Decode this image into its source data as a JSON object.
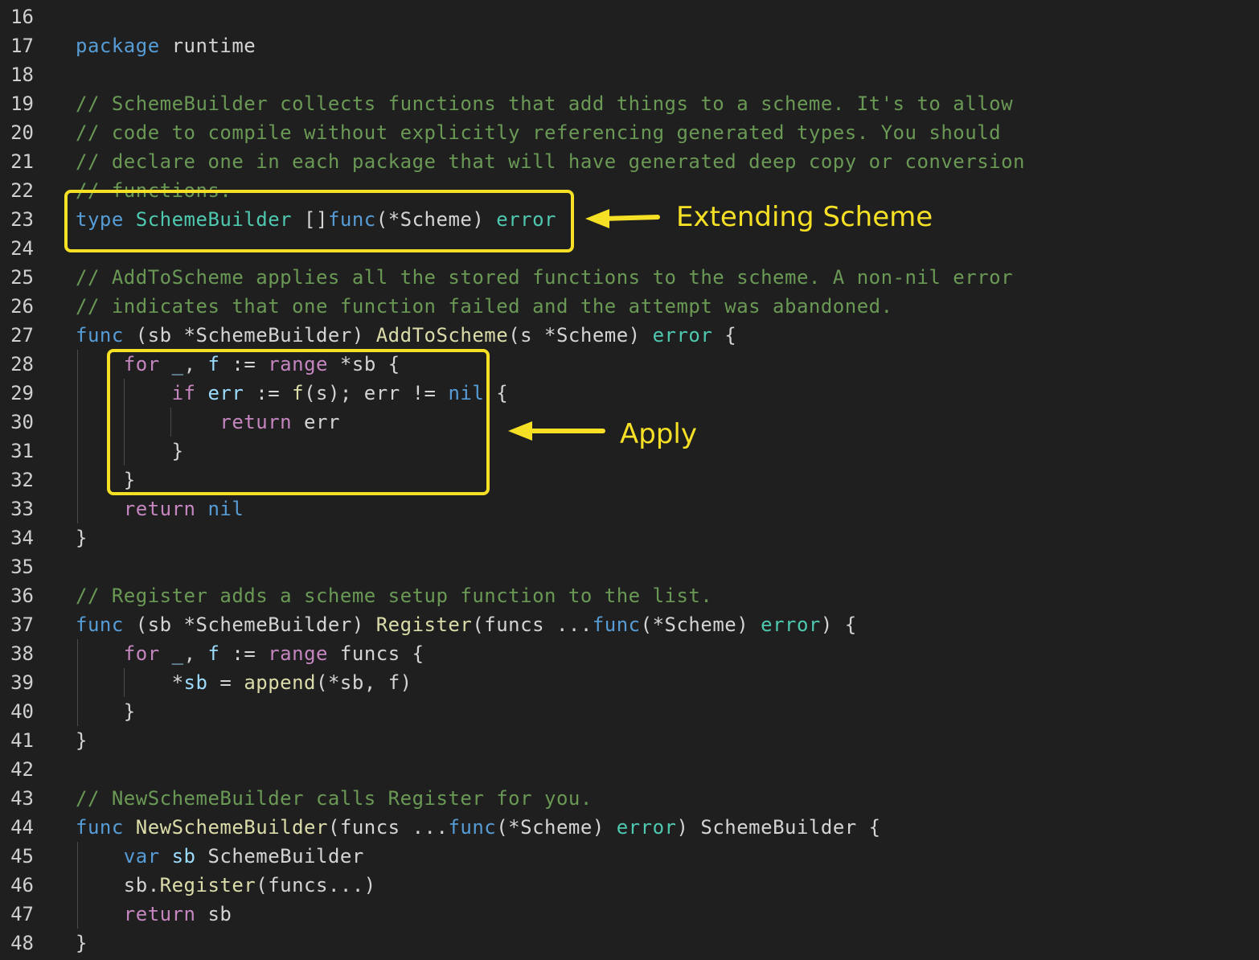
{
  "colors": {
    "background": "#1f1f1f",
    "plain": "#d4d4d4",
    "keyword": "#569cd6",
    "control": "#c586c0",
    "type": "#4ec9b0",
    "function": "#dcdcaa",
    "variable": "#9cdcfe",
    "comment": "#6a9955",
    "line_number": "#cfcfcf",
    "annotation": "#f6e025"
  },
  "lines": [
    {
      "n": "16",
      "t": []
    },
    {
      "n": "17",
      "t": [
        [
          "kw",
          "package"
        ],
        [
          "p",
          " runtime"
        ]
      ]
    },
    {
      "n": "18",
      "t": []
    },
    {
      "n": "19",
      "t": [
        [
          "cm",
          "// SchemeBuilder collects functions that add things to a scheme. It's to allow"
        ]
      ]
    },
    {
      "n": "20",
      "t": [
        [
          "cm",
          "// code to compile without explicitly referencing generated types. You should"
        ]
      ]
    },
    {
      "n": "21",
      "t": [
        [
          "cm",
          "// declare one in each package that will have generated deep copy or conversion"
        ]
      ]
    },
    {
      "n": "22",
      "t": [
        [
          "cm",
          "// functions."
        ]
      ]
    },
    {
      "n": "23",
      "t": [
        [
          "kw",
          "type"
        ],
        [
          "p",
          " "
        ],
        [
          "ty",
          "SchemeBuilder"
        ],
        [
          "p",
          " []"
        ],
        [
          "kw",
          "func"
        ],
        [
          "p",
          "(*Scheme) "
        ],
        [
          "ty",
          "error"
        ]
      ]
    },
    {
      "n": "24",
      "t": []
    },
    {
      "n": "25",
      "t": [
        [
          "cm",
          "// AddToScheme applies all the stored functions to the scheme. A non-nil error"
        ]
      ]
    },
    {
      "n": "26",
      "t": [
        [
          "cm",
          "// indicates that one function failed and the attempt was abandoned."
        ]
      ]
    },
    {
      "n": "27",
      "t": [
        [
          "kw",
          "func"
        ],
        [
          "p",
          " (sb *SchemeBuilder) "
        ],
        [
          "fn",
          "AddToScheme"
        ],
        [
          "p",
          "(s *Scheme) "
        ],
        [
          "ty",
          "error"
        ],
        [
          "p",
          " {"
        ]
      ]
    },
    {
      "n": "28",
      "t": [
        [
          "p",
          "    "
        ],
        [
          "ct",
          "for"
        ],
        [
          "p",
          " "
        ],
        [
          "va",
          "_"
        ],
        [
          "p",
          ", "
        ],
        [
          "va",
          "f"
        ],
        [
          "p",
          " := "
        ],
        [
          "ct",
          "range"
        ],
        [
          "p",
          " *sb {"
        ]
      ]
    },
    {
      "n": "29",
      "t": [
        [
          "p",
          "        "
        ],
        [
          "ct",
          "if"
        ],
        [
          "p",
          " "
        ],
        [
          "va",
          "err"
        ],
        [
          "p",
          " := "
        ],
        [
          "fn",
          "f"
        ],
        [
          "p",
          "(s); err != "
        ],
        [
          "kw",
          "nil"
        ],
        [
          "p",
          " {"
        ]
      ]
    },
    {
      "n": "30",
      "t": [
        [
          "p",
          "            "
        ],
        [
          "ct",
          "return"
        ],
        [
          "p",
          " err"
        ]
      ]
    },
    {
      "n": "31",
      "t": [
        [
          "p",
          "        }"
        ]
      ]
    },
    {
      "n": "32",
      "t": [
        [
          "p",
          "    }"
        ]
      ]
    },
    {
      "n": "33",
      "t": [
        [
          "p",
          "    "
        ],
        [
          "ct",
          "return"
        ],
        [
          "p",
          " "
        ],
        [
          "kw",
          "nil"
        ]
      ]
    },
    {
      "n": "34",
      "t": [
        [
          "p",
          "}"
        ]
      ]
    },
    {
      "n": "35",
      "t": []
    },
    {
      "n": "36",
      "t": [
        [
          "cm",
          "// Register adds a scheme setup function to the list."
        ]
      ]
    },
    {
      "n": "37",
      "t": [
        [
          "kw",
          "func"
        ],
        [
          "p",
          " (sb *SchemeBuilder) "
        ],
        [
          "fn",
          "Register"
        ],
        [
          "p",
          "(funcs ..."
        ],
        [
          "kw",
          "func"
        ],
        [
          "p",
          "(*Scheme) "
        ],
        [
          "ty",
          "error"
        ],
        [
          "p",
          ") {"
        ]
      ]
    },
    {
      "n": "38",
      "t": [
        [
          "p",
          "    "
        ],
        [
          "ct",
          "for"
        ],
        [
          "p",
          " "
        ],
        [
          "va",
          "_"
        ],
        [
          "p",
          ", "
        ],
        [
          "va",
          "f"
        ],
        [
          "p",
          " := "
        ],
        [
          "ct",
          "range"
        ],
        [
          "p",
          " funcs {"
        ]
      ]
    },
    {
      "n": "39",
      "t": [
        [
          "p",
          "        *"
        ],
        [
          "va",
          "sb"
        ],
        [
          "p",
          " = "
        ],
        [
          "fn",
          "append"
        ],
        [
          "p",
          "(*sb, f)"
        ]
      ]
    },
    {
      "n": "40",
      "t": [
        [
          "p",
          "    }"
        ]
      ]
    },
    {
      "n": "41",
      "t": [
        [
          "p",
          "}"
        ]
      ]
    },
    {
      "n": "42",
      "t": []
    },
    {
      "n": "43",
      "t": [
        [
          "cm",
          "// NewSchemeBuilder calls Register for you."
        ]
      ]
    },
    {
      "n": "44",
      "t": [
        [
          "kw",
          "func"
        ],
        [
          "p",
          " "
        ],
        [
          "fn",
          "NewSchemeBuilder"
        ],
        [
          "p",
          "(funcs ..."
        ],
        [
          "kw",
          "func"
        ],
        [
          "p",
          "(*Scheme) "
        ],
        [
          "ty",
          "error"
        ],
        [
          "p",
          ") SchemeBuilder {"
        ]
      ]
    },
    {
      "n": "45",
      "t": [
        [
          "p",
          "    "
        ],
        [
          "kw",
          "var"
        ],
        [
          "p",
          " "
        ],
        [
          "va",
          "sb"
        ],
        [
          "p",
          " SchemeBuilder"
        ]
      ]
    },
    {
      "n": "46",
      "t": [
        [
          "p",
          "    sb."
        ],
        [
          "fn",
          "Register"
        ],
        [
          "p",
          "(funcs...)"
        ]
      ]
    },
    {
      "n": "47",
      "t": [
        [
          "p",
          "    "
        ],
        [
          "ct",
          "return"
        ],
        [
          "p",
          " sb"
        ]
      ]
    },
    {
      "n": "48",
      "t": [
        [
          "p",
          "}"
        ]
      ]
    }
  ],
  "annotations": {
    "extending": "Extending Scheme",
    "apply": "Apply"
  }
}
